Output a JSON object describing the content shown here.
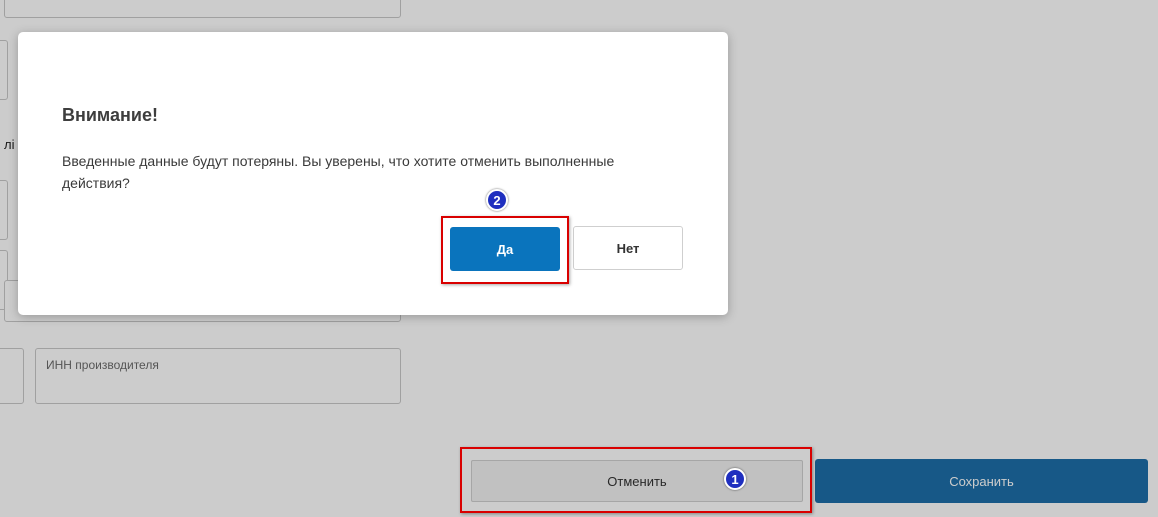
{
  "background_form": {
    "label_fragment": "лі",
    "manufacturer_inn_placeholder": "ИНН производителя",
    "cancel_label": "Отменить",
    "save_label": "Сохранить"
  },
  "dialog": {
    "title": "Внимание!",
    "message": "Введенные данные будут потеряны. Вы уверены, что хотите отменить выполненные действия?",
    "yes_label": "Да",
    "no_label": "Нет"
  },
  "annotations": {
    "step1": "1",
    "step2": "2"
  },
  "colors": {
    "accent": "#0a74bd",
    "highlight": "#d90000",
    "badge": "#1f2fbf"
  }
}
